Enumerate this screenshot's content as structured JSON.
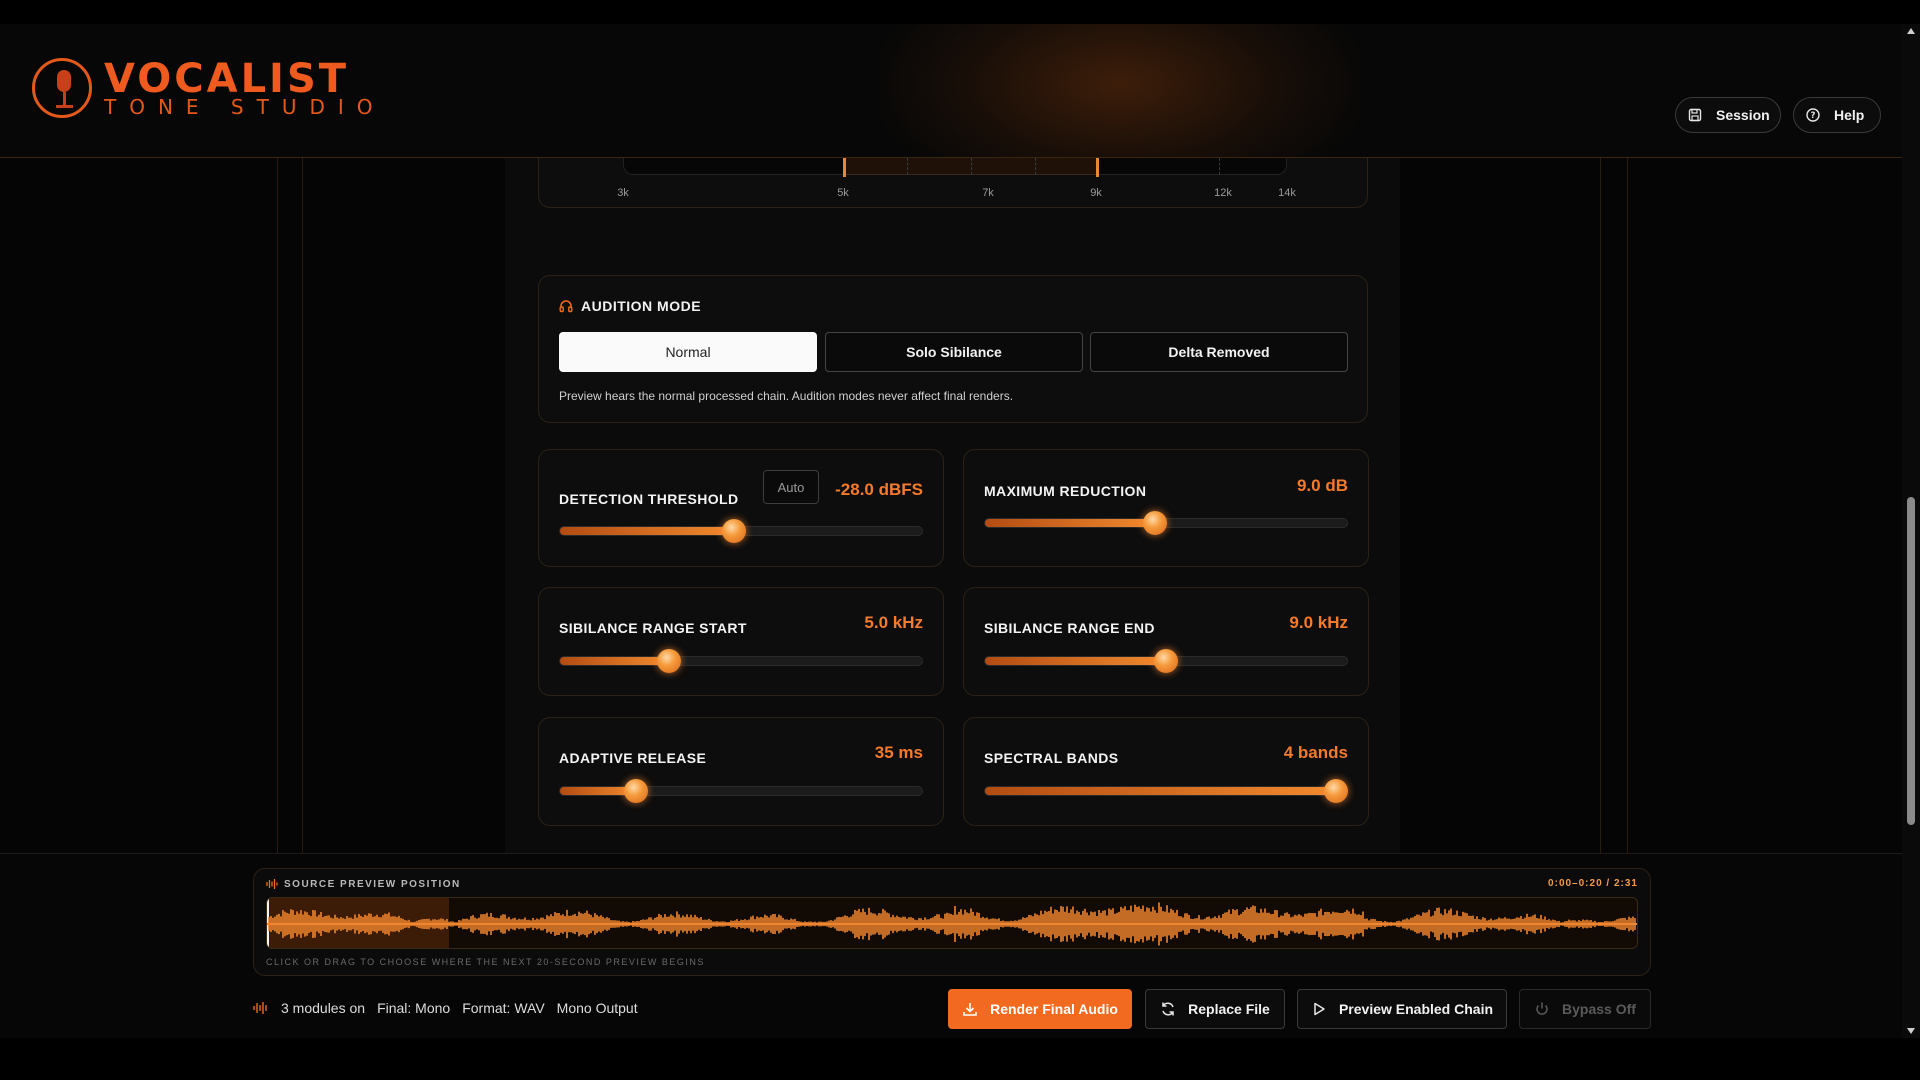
{
  "app": {
    "logo_title": "VOCALIST",
    "logo_subtitle": "TONE STUDIO"
  },
  "header": {
    "session_label": "Session",
    "help_label": "Help"
  },
  "frequency_axis": {
    "ticks": [
      {
        "label": "3k",
        "value": 3
      },
      {
        "label": "5k",
        "value": 5
      },
      {
        "label": "7k",
        "value": 7
      },
      {
        "label": "9k",
        "value": 9
      },
      {
        "label": "12k",
        "value": 12
      },
      {
        "label": "14k",
        "value": 14
      }
    ],
    "range_start_khz": 5,
    "range_end_khz": 9
  },
  "audition": {
    "title": "AUDITION MODE",
    "options": [
      "Normal",
      "Solo Sibilance",
      "Delta Removed"
    ],
    "selected": "Normal",
    "note": "Preview hears the normal processed chain. Audition modes never affect final renders."
  },
  "controls": {
    "detection_threshold": {
      "label": "DETECTION THRESHOLD",
      "value": "-28.0 dBFS",
      "auto_label": "Auto",
      "fill_percent": 48
    },
    "maximum_reduction": {
      "label": "MAXIMUM REDUCTION",
      "value": "9.0 dB",
      "fill_percent": 47
    },
    "range_start": {
      "label": "SIBILANCE RANGE START",
      "value": "5.0 kHz",
      "fill_percent": 30
    },
    "range_end": {
      "label": "SIBILANCE RANGE END",
      "value": "9.0 kHz",
      "fill_percent": 50
    },
    "adaptive_release": {
      "label": "ADAPTIVE RELEASE",
      "value": "35 ms",
      "fill_percent": 21
    },
    "spectral_bands": {
      "label": "SPECTRAL BANDS",
      "value": "4 bands",
      "fill_percent": 97
    }
  },
  "preview": {
    "title": "SOURCE PREVIEW POSITION",
    "time": "0:00–0:20 / 2:31",
    "hint": "CLICK OR DRAG TO CHOOSE WHERE THE NEXT 20-SECOND PREVIEW BEGINS"
  },
  "status": {
    "modules": "3 modules on",
    "final": "Final: Mono",
    "format": "Format: WAV",
    "output": "Mono Output"
  },
  "actions": {
    "render": "Render Final Audio",
    "replace": "Replace File",
    "preview": "Preview Enabled Chain",
    "bypass": "Bypass Off"
  },
  "colors": {
    "accent": "#f26a1f",
    "value_text": "#f47a2c"
  }
}
